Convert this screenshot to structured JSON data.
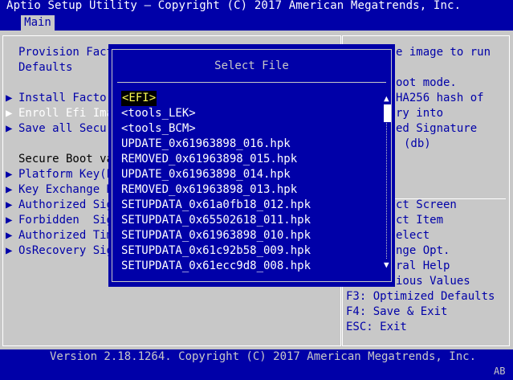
{
  "header": {
    "title": "Aptio Setup Utility – Copyright (C) 2017 American Megatrends, Inc.",
    "tab_main": "Main"
  },
  "left": {
    "provision_1": "Provision Fact",
    "provision_2": "Defaults",
    "install_factory": "Install Factor",
    "enroll_efi": "Enroll Efi Ima",
    "save_all": "Save all Secur",
    "secure_boot_vars": "Secure Boot va",
    "platform_key": "Platform Key(P",
    "key_exchange": "Key Exchange K",
    "authorized_sig": "Authorized Sig",
    "forbidden_sig": "Forbidden  Sig",
    "authorized_time": "Authorized Tim",
    "osrecovery": "OsRecovery Sig"
  },
  "right": {
    "help_1": "e image to run",
    "help_2": "oot mode.",
    "help_3": "HA256 hash of",
    "help_4": "ry into",
    "help_5": "ed Signature",
    "help_6": "(db)",
    "key_select_screen": "ct Screen",
    "key_select_item": "ct Item",
    "key_select": "elect",
    "key_change": "nge Opt.",
    "key_general": "ral Help",
    "key_previous": "ious Values",
    "key_f3": "F3: Optimized Defaults",
    "key_f4": "F4: Save & Exit",
    "key_esc": "ESC: Exit"
  },
  "dialog": {
    "title": "Select File",
    "files": [
      "<EFI>",
      "<tools_LEK>",
      "<tools_BCM>",
      "UPDATE_0x61963898_016.hpk",
      "REMOVED_0x61963898_015.hpk",
      "UPDATE_0x61963898_014.hpk",
      "REMOVED_0x61963898_013.hpk",
      "SETUPDATA_0x61a0fb18_012.hpk",
      "SETUPDATA_0x65502618_011.hpk",
      "SETUPDATA_0x61963898_010.hpk",
      "SETUPDATA_0x61c92b58_009.hpk",
      "SETUPDATA_0x61ecc9d8_008.hpk"
    ],
    "selected_index": 0
  },
  "footer": {
    "version": "Version 2.18.1264. Copyright (C) 2017 American Megatrends, Inc.",
    "badge": "AB"
  },
  "colors": {
    "background": "#0000a8",
    "panel": "#c8c8c8",
    "selected_text": "#ffff55"
  },
  "icons": {
    "submenu_arrow": "triangle-right",
    "scroll_up": "triangle-up",
    "scroll_down": "triangle-down"
  }
}
